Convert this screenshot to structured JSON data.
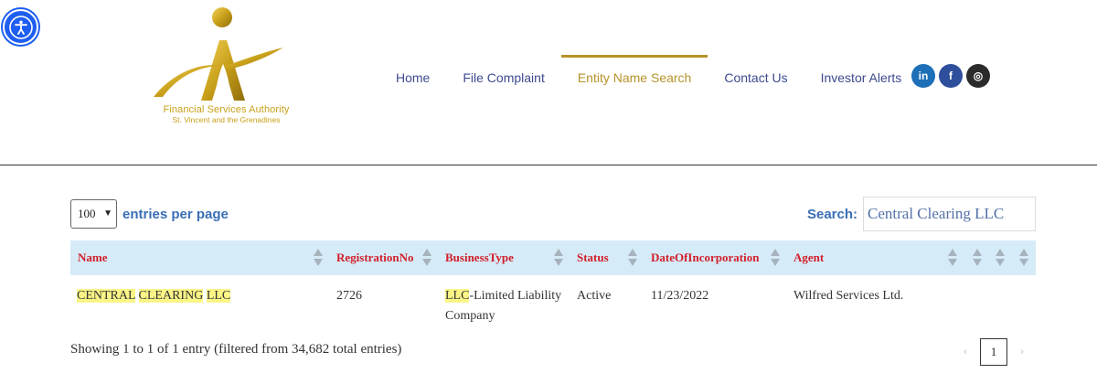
{
  "logo": {
    "line1": "Financial Services Authority",
    "line2": "St. Vincent and the Grenadines",
    "gold": "#c9a01a"
  },
  "nav": {
    "items": [
      {
        "label": "Home"
      },
      {
        "label": "File Complaint"
      },
      {
        "label": "Entity Name Search",
        "active": true
      },
      {
        "label": "Contact Us"
      },
      {
        "label": "Investor Alerts"
      }
    ],
    "active_color": "#b7922b",
    "text_color": "#3d4a8f"
  },
  "socials": [
    {
      "icon": "linkedin-icon",
      "glyph": "in"
    },
    {
      "icon": "facebook-icon",
      "glyph": "f"
    },
    {
      "icon": "instagram-icon",
      "glyph": "◎"
    }
  ],
  "controls": {
    "entries_value": "100",
    "entries_label": "entries per page",
    "search_label": "Search:",
    "search_value": "Central Clearing LLC"
  },
  "table": {
    "columns": [
      "Name",
      "RegistrationNo",
      "BusinessType",
      "Status",
      "DateOfIncorporation",
      "Agent"
    ],
    "rows": [
      {
        "name_parts": [
          "CENTRAL",
          "CLEARING",
          "LLC"
        ],
        "registration_no": "2726",
        "business_type_highlight": "LLC",
        "business_type_rest": "-Limited Liability",
        "business_type_line2": "Company",
        "status": "Active",
        "date_of_incorporation": "11/23/2022",
        "agent": "Wilfred Services Ltd."
      }
    ],
    "header_bg": "#d6ebf8",
    "header_text": "#d11f2a",
    "highlight": "#fbf586"
  },
  "footer": {
    "info": "Showing 1 to 1 of 1 entry (filtered from 34,682 total entries)",
    "prev": "‹",
    "page": "1",
    "next": "›"
  }
}
